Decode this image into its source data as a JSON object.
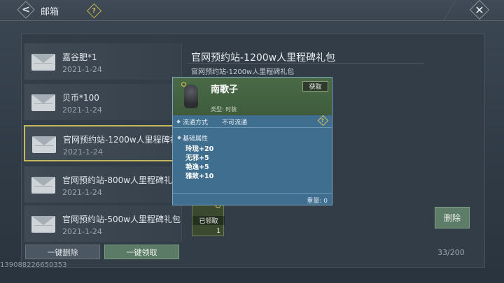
{
  "header": {
    "title": "邮箱",
    "help_glyph": "?",
    "back_glyph": "<",
    "close_glyph": "✕"
  },
  "mails": [
    {
      "title": "嘉谷肥*1",
      "date": "2021-1-24",
      "selected": false
    },
    {
      "title": "贝币*100",
      "date": "2021-1-24",
      "selected": false
    },
    {
      "title": "官网预约站-1200w人里程碑礼",
      "date": "2021-1-24",
      "selected": true
    },
    {
      "title": "官网预约站-800w人里程碑礼包",
      "date": "2021-1-24",
      "selected": false
    },
    {
      "title": "官网预约站-500w人里程碑礼包",
      "date": "2021-1-24",
      "selected": false
    }
  ],
  "detail": {
    "title": "官网预约站-1200w人里程碑礼包",
    "subtitle": "官网预约站-1200w人里程碑礼包",
    "reward": {
      "status": "已领取",
      "quantity": "1"
    },
    "delete_label": "删除"
  },
  "popup": {
    "name": "南歌子",
    "obtain_label": "获取",
    "type_text": "类型: 时装",
    "trade_label": "流通方式",
    "trade_value": "不可流通",
    "help_glyph": "?",
    "attr_title": "基础属性",
    "attributes": [
      "玲珑+20",
      "无邪+5",
      "艳逸+5",
      "雅致+10"
    ],
    "weight_text": "重量: 0"
  },
  "footer": {
    "delete_all_label": "一键删除",
    "claim_all_label": "一键领取",
    "count": "33/200",
    "uid": "139088226650353"
  },
  "colors": {
    "accent_gold": "#c8b85a",
    "green_button": "#5c7b66",
    "popup_blue": "#3f6e8f"
  }
}
